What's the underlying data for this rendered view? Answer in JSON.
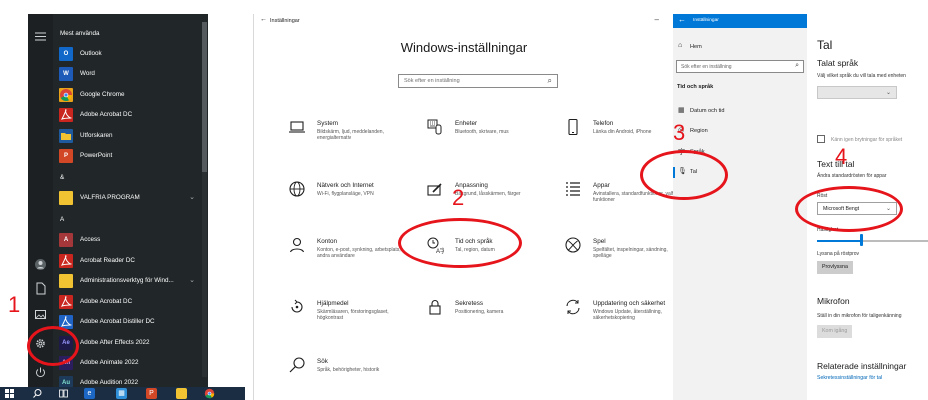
{
  "start_menu": {
    "section_most_used": "Mest använda",
    "items": [
      {
        "label": "Outlook",
        "tile": "O",
        "color": "#1168c8"
      },
      {
        "label": "Word",
        "tile": "W",
        "color": "#1e5bb8"
      },
      {
        "label": "Google Chrome",
        "tile": "",
        "color": "#e8a318"
      },
      {
        "label": "Adobe Acrobat DC",
        "tile": "",
        "color": "#c8261e"
      },
      {
        "label": "Utforskaren",
        "tile": "",
        "color": "#f1c232"
      },
      {
        "label": "PowerPoint",
        "tile": "P",
        "color": "#d24726"
      }
    ],
    "group_amp": "&",
    "valfria": "VALFRIA PROGRAM",
    "group_a": "A",
    "a_items": [
      {
        "label": "Access",
        "tile": "A",
        "color": "#a4373a"
      },
      {
        "label": "Acrobat Reader DC",
        "tile": "",
        "color": "#c8261e"
      },
      {
        "label": "Administrationsverktyg för Wind...",
        "tile": "",
        "color": "#f1c232"
      },
      {
        "label": "Adobe Acrobat DC",
        "tile": "",
        "color": "#c8261e"
      },
      {
        "label": "Adobe Acrobat Distiller DC",
        "tile": "",
        "color": "#1f63c6"
      },
      {
        "label": "Adobe After Effects 2022",
        "tile": "Ae",
        "color": "#1d1a4a"
      },
      {
        "label": "Adobe Animate 2022",
        "tile": "An",
        "color": "#2a1e5e"
      },
      {
        "label": "Adobe Audition 2022",
        "tile": "Au",
        "color": "#1e3a5a"
      }
    ]
  },
  "annotations": {
    "n1": "1",
    "n2": "2",
    "n3": "3",
    "n4": "4"
  },
  "settings_home": {
    "window_title": "Inställningar",
    "heading": "Windows-inställningar",
    "search_placeholder": "Sök efter en inställning",
    "categories": [
      {
        "title": "System",
        "desc": "Bildskärm, ljud, meddelanden, energialternativ",
        "icon": "laptop-icon"
      },
      {
        "title": "Enheter",
        "desc": "Bluetooth, skrivare, mus",
        "icon": "keyboard-icon"
      },
      {
        "title": "Telefon",
        "desc": "Länka din Android, iPhone",
        "icon": "phone-icon"
      },
      {
        "title": "Nätverk och Internet",
        "desc": "Wi-Fi, flygplansläge, VPN",
        "icon": "globe-icon"
      },
      {
        "title": "Anpassning",
        "desc": "Bakgrund, låsskärmen, färger",
        "icon": "paintbrush-icon"
      },
      {
        "title": "Appar",
        "desc": "Avinstallera, standardfunktioner, valfria funktioner",
        "icon": "apps-icon"
      },
      {
        "title": "Konton",
        "desc": "Konton, e-post, synkning, arbetsplats, andra användare",
        "icon": "person-icon"
      },
      {
        "title": "Tid och språk",
        "desc": "Tal, region, datum",
        "icon": "time-language-icon"
      },
      {
        "title": "Spel",
        "desc": "Spelfältet, inspelningar, sändning, spelläge",
        "icon": "xbox-icon"
      },
      {
        "title": "Hjälpmedel",
        "desc": "Skärmläsaren, förstoringsglaset, högkontrast",
        "icon": "accessibility-icon"
      },
      {
        "title": "Sekretess",
        "desc": "Positionering, kamera",
        "icon": "lock-icon"
      },
      {
        "title": "Uppdatering och säkerhet",
        "desc": "Windows Update, återställning, säkerhetskopiering",
        "icon": "update-icon"
      },
      {
        "title": "Sök",
        "desc": "Språk, behörigheter, historik",
        "icon": "search-icon"
      }
    ]
  },
  "nav_pane": {
    "window_title": "Inställningar",
    "home": "Hem",
    "search_placeholder": "Sök efter en inställning",
    "section": "Tid och språk",
    "items": [
      {
        "label": "Datum och tid",
        "icon": "calendar-clock-icon"
      },
      {
        "label": "Region",
        "icon": "region-icon"
      },
      {
        "label": "Språk",
        "icon": "language-icon"
      },
      {
        "label": "Tal",
        "icon": "microphone-icon",
        "selected": true
      }
    ]
  },
  "speech_page": {
    "title": "Tal",
    "speech_language_heading": "Talat språk",
    "speech_language_desc": "Välj vilket språk du vill tala med enheten",
    "recognize_accents": "Känn igen brytningar för språket",
    "tts_heading": "Text till tal",
    "tts_desc": "Ändra standardrösten för appar",
    "voice_label": "Röst",
    "voice_value": "Microsoft Bengt",
    "speed_label": "Hastighet",
    "speed_fraction": 0.4,
    "preview_label": "Lyssna på röstprov",
    "preview_button": "Provlyssna",
    "mic_heading": "Mikrofon",
    "mic_desc": "Ställ in din mikrofon för taligenkänning",
    "mic_button": "Kom igång",
    "related_heading": "Relaterade inställningar",
    "related_link": "Sekretessinställningar för tal"
  },
  "colors": {
    "accent": "#0078d7",
    "annotation_red": "#e6141b",
    "startmenu_bg": "#212628"
  }
}
